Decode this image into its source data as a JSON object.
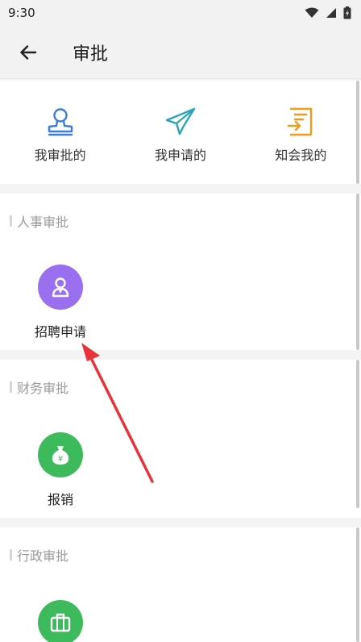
{
  "status_bar": {
    "time": "9:30"
  },
  "header": {
    "title": "审批"
  },
  "quick_actions": [
    {
      "label": "我审批的",
      "icon": "approver-stamp-icon",
      "color": "#3b7ddd"
    },
    {
      "label": "我申请的",
      "icon": "paper-plane-icon",
      "color": "#2aa6b8"
    },
    {
      "label": "知会我的",
      "icon": "document-forward-icon",
      "color": "#f29a1d"
    }
  ],
  "sections": [
    {
      "title": "人事审批",
      "items": [
        {
          "label": "招聘申请",
          "icon": "recruit-person-icon",
          "color": "#9a6ff0"
        }
      ]
    },
    {
      "title": "财务审批",
      "items": [
        {
          "label": "报销",
          "icon": "money-bag-icon",
          "color": "#3dbb5c"
        }
      ]
    },
    {
      "title": "行政审批",
      "items": [
        {
          "label": "",
          "icon": "briefcase-icon",
          "color": "#3dbb5c"
        }
      ]
    }
  ],
  "annotation": {
    "type": "red-arrow",
    "color": "#e8333a"
  }
}
